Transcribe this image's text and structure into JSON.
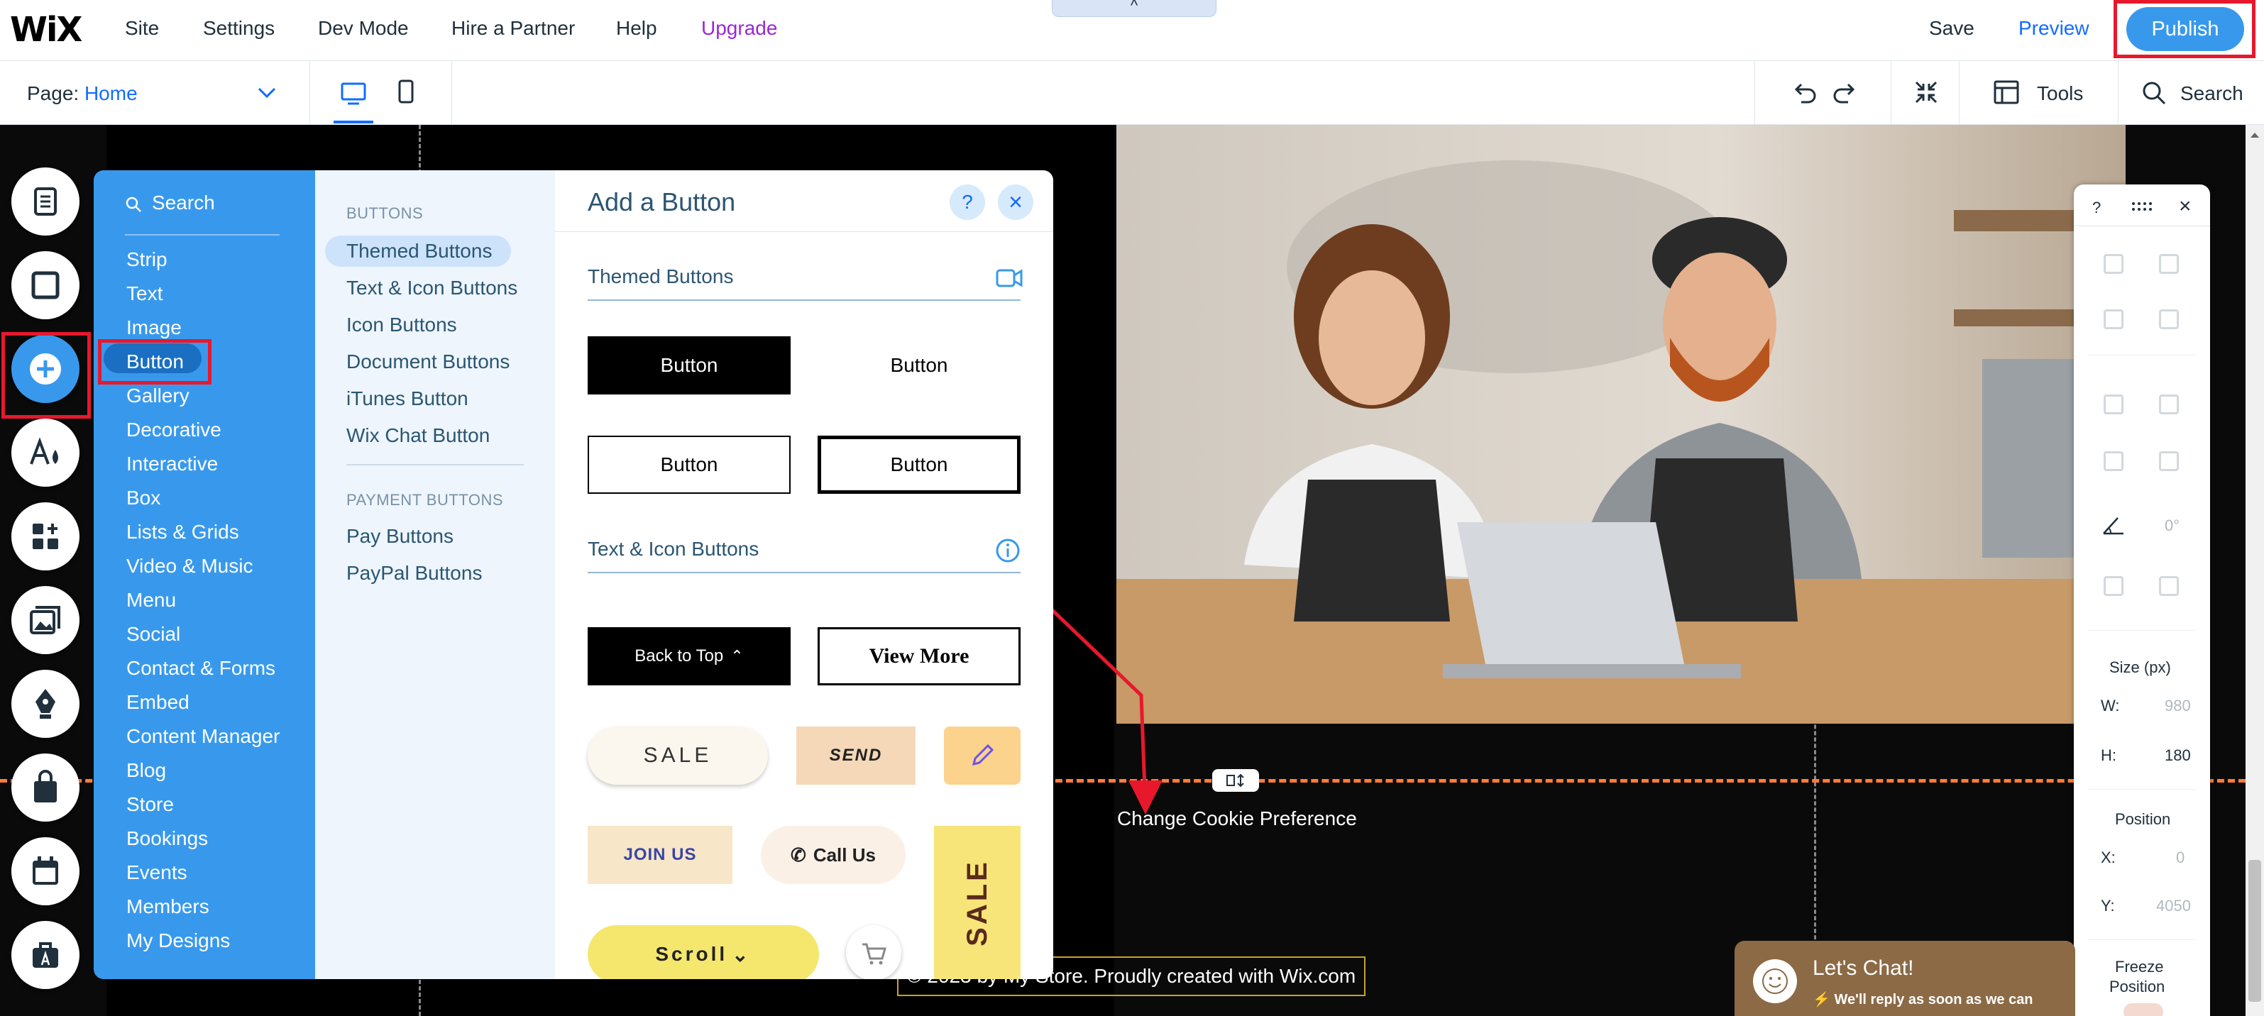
{
  "topbar": {
    "logo": "WiX",
    "menu": [
      "Site",
      "Settings",
      "Dev Mode",
      "Hire a Partner",
      "Help",
      "Upgrade"
    ],
    "save": "Save",
    "preview": "Preview",
    "publish": "Publish",
    "collapse": "^"
  },
  "secbar": {
    "page_label": "Page:",
    "page_value": "Home",
    "tools": "Tools",
    "search": "Search"
  },
  "categories": {
    "search": "Search",
    "items": [
      "Strip",
      "Text",
      "Image",
      "Button",
      "Gallery",
      "Decorative",
      "Interactive",
      "Box",
      "Lists & Grids",
      "Video & Music",
      "Menu",
      "Social",
      "Contact & Forms",
      "Embed",
      "Content Manager",
      "Blog",
      "Store",
      "Bookings",
      "Events",
      "Members",
      "My Designs"
    ],
    "selected": "Button"
  },
  "subpanel": {
    "buttons_header": "BUTTONS",
    "buttons": [
      "Themed Buttons",
      "Text & Icon Buttons",
      "Icon Buttons",
      "Document Buttons",
      "iTunes Button",
      "Wix Chat Button"
    ],
    "payment_header": "PAYMENT BUTTONS",
    "payment": [
      "Pay Buttons",
      "PayPal Buttons"
    ]
  },
  "addpanel": {
    "title": "Add a Button",
    "help": "?",
    "close": "×",
    "themed_title": "Themed Buttons",
    "themed": [
      "Button",
      "Button",
      "Button",
      "Button"
    ],
    "texticon_title": "Text & Icon Buttons",
    "back_to_top": "Back to Top",
    "view_more": "View More",
    "sale": "SALE",
    "send": "SEND",
    "join_us": "JOIN US",
    "call_us": "Call Us",
    "sale_vertical": "SALE",
    "scroll": "Scroll"
  },
  "canvas": {
    "cookie": "Change Cookie Preference",
    "footer": "© 2023 by My Store. Proudly created with Wix.com"
  },
  "rightpanel": {
    "help": "?",
    "close": "×",
    "angle": "0°",
    "size_title": "Size (px)",
    "w_label": "W:",
    "w_value": "980",
    "h_label": "H:",
    "h_value": "180",
    "position_title": "Position",
    "x_label": "X:",
    "x_value": "0",
    "y_label": "Y:",
    "y_value": "4050",
    "freeze_line1": "Freeze",
    "freeze_line2": "Position"
  },
  "chat": {
    "title": "Let's Chat!",
    "subtitle": "We'll reply as soon as we can"
  },
  "colors": {
    "accent": "#3899ec",
    "highlight": "#e8182c",
    "upgrade": "#9a27d5",
    "section_line": "#ff7d38"
  }
}
